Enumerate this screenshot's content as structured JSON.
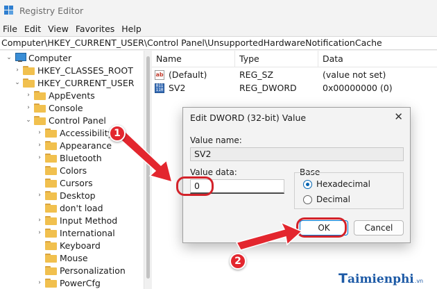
{
  "window": {
    "title": "Registry Editor"
  },
  "menu": [
    "File",
    "Edit",
    "View",
    "Favorites",
    "Help"
  ],
  "address": "Computer\\HKEY_CURRENT_USER\\Control Panel\\UnsupportedHardwareNotificationCache",
  "tree": {
    "root": "Computer",
    "items": [
      "HKEY_CLASSES_ROOT",
      "HKEY_CURRENT_USER",
      "AppEvents",
      "Console",
      "Control Panel",
      "Accessibility",
      "Appearance",
      "Bluetooth",
      "Colors",
      "Cursors",
      "Desktop",
      "don't load",
      "Input Method",
      "International",
      "Keyboard",
      "Mouse",
      "Personalization",
      "PowerCfg"
    ]
  },
  "list": {
    "columns": [
      "Name",
      "Type",
      "Data"
    ],
    "rows": [
      {
        "name": "(Default)",
        "type": "REG_SZ",
        "data": "(value not set)",
        "icon": "string-value-icon"
      },
      {
        "name": "SV2",
        "type": "REG_DWORD",
        "data": "0x00000000 (0)",
        "icon": "binary-value-icon"
      }
    ]
  },
  "dialog": {
    "title": "Edit DWORD (32-bit) Value",
    "value_name_label": "Value name:",
    "value_name": "SV2",
    "value_data_label": "Value data:",
    "value_data": "0",
    "base_label": "Base",
    "base_options": [
      "Hexadecimal",
      "Decimal"
    ],
    "base_selected": "Hexadecimal",
    "ok": "OK",
    "cancel": "Cancel"
  },
  "annotations": {
    "step1": "1",
    "step2": "2",
    "accent": "#e3262e"
  },
  "watermark": {
    "first": "T",
    "rest": "aimienphi",
    "suffix": ".vn"
  }
}
